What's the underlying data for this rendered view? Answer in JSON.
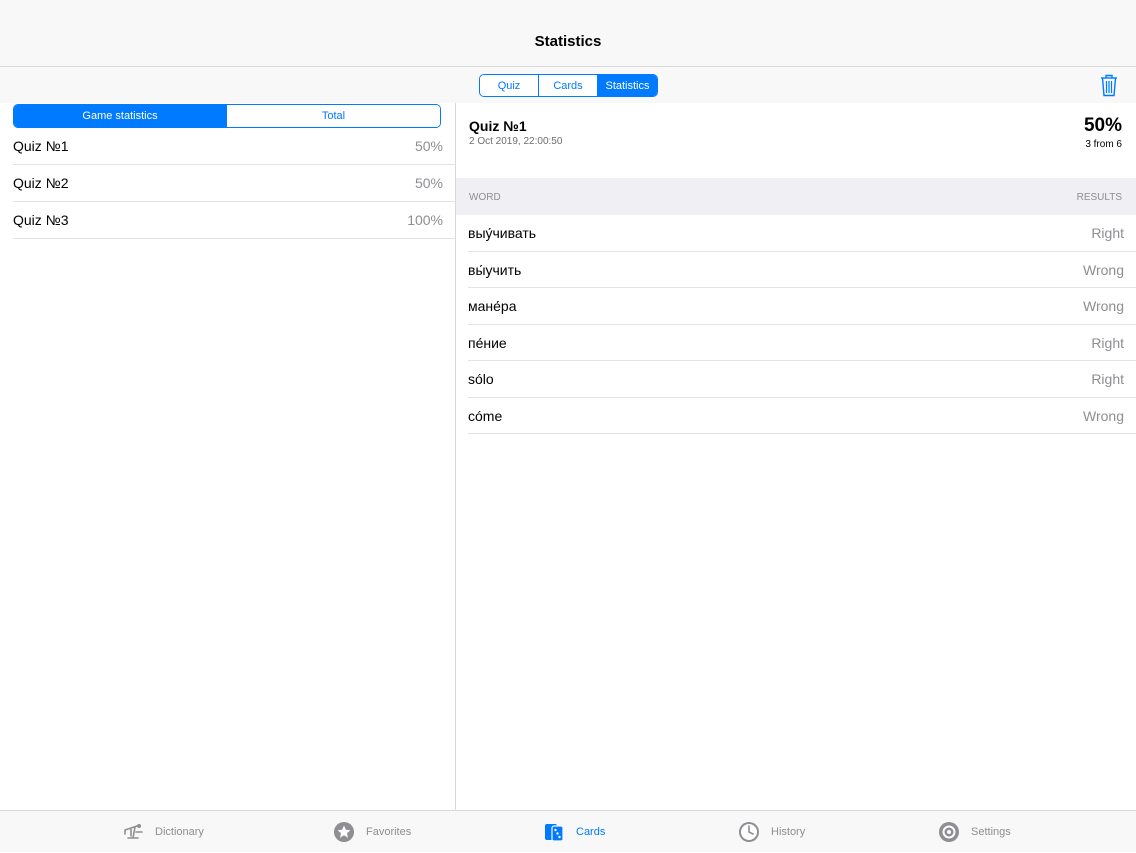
{
  "header": {
    "title": "Statistics"
  },
  "top_segment": {
    "items": [
      {
        "label": "Quiz",
        "active": false
      },
      {
        "label": "Cards",
        "active": false
      },
      {
        "label": "Statistics",
        "active": true
      }
    ]
  },
  "trash_icon": "trash-icon",
  "left": {
    "segment": {
      "items": [
        {
          "label": "Game statistics",
          "active": true
        },
        {
          "label": "Total",
          "active": false
        }
      ]
    },
    "quizzes": [
      {
        "name": "Quiz №1",
        "percent": "50%"
      },
      {
        "name": "Quiz №2",
        "percent": "50%"
      },
      {
        "name": "Quiz №3",
        "percent": "100%"
      }
    ]
  },
  "detail": {
    "title": "Quiz №1",
    "date": "2 Oct 2019, 22:00:50",
    "percent": "50%",
    "count": "3 from 6",
    "columns": {
      "word": "WORD",
      "results": "RESULTS"
    },
    "words": [
      {
        "word": "выу́чивать",
        "result": "Right"
      },
      {
        "word": "вы́учить",
        "result": "Wrong"
      },
      {
        "word": "мане́ра",
        "result": "Wrong"
      },
      {
        "word": "пе́ние",
        "result": "Right"
      },
      {
        "word": "sólo",
        "result": "Right"
      },
      {
        "word": "cóme",
        "result": "Wrong"
      }
    ]
  },
  "tabbar": {
    "items": [
      {
        "label": "Dictionary",
        "icon": "dictionary-icon",
        "active": false
      },
      {
        "label": "Favorites",
        "icon": "star-icon",
        "active": false
      },
      {
        "label": "Cards",
        "icon": "cards-icon",
        "active": true
      },
      {
        "label": "History",
        "icon": "clock-icon",
        "active": false
      },
      {
        "label": "Settings",
        "icon": "gear-icon",
        "active": false
      }
    ]
  },
  "colors": {
    "accent": "#007aff",
    "secondary_text": "#8e8e93",
    "bar_bg": "#f8f8f8"
  }
}
